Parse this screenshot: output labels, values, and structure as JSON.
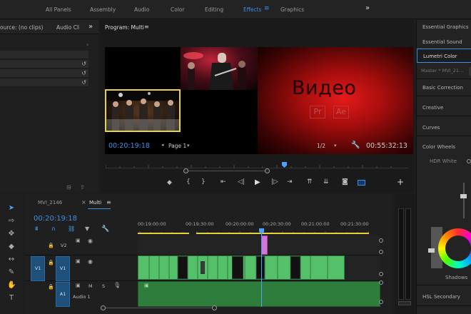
{
  "workspace": {
    "tabs": [
      "All Panels",
      "Assembly",
      "Audio",
      "Color",
      "Editing",
      "Effects",
      "Graphics"
    ],
    "active_tab": "Effects",
    "menu_icon": "hamburger-icon",
    "overflow": "»"
  },
  "source": {
    "title": "ource: (no clips)",
    "audio_tab": "Audio Cli",
    "overflow": "»"
  },
  "program": {
    "title": "Program: Multi",
    "menu": "≡",
    "timecode_in": "00:20:19:18",
    "page_select": "Page 1",
    "zoom_select": "1/2",
    "timecode_out": "00:55:32:13",
    "video_title": "Видео",
    "badge_pr": "Pr",
    "badge_ae": "Ae"
  },
  "timeline": {
    "tab_inactive": "MVI_2146",
    "tab_active": "Multi",
    "tab_menu": "≡",
    "timecode": "00:20:19:18",
    "ruler": [
      "00:19:00:00",
      "00:19:30:00",
      "00:20:00:00",
      "00:20:30:00",
      "00:21:00:00",
      "00:21:30:00"
    ],
    "tracks": {
      "v2": "V2",
      "v1_src": "V1",
      "v1": "V1",
      "a1_src": "A1",
      "a1": "A1",
      "a1_name": "Audio 1",
      "m": "M",
      "s": "S"
    }
  },
  "right_panel": {
    "essential_graphics": "Essential Graphics",
    "essential_sound": "Essential Sound",
    "lumetri": "Lumetri Color",
    "master": "Master * MVI_21...",
    "basic_correction": "Basic Correction",
    "creative": "Creative",
    "curves": "Curves",
    "color_wheels": "Color Wheels",
    "hdr_white": "HDR White",
    "shadows": "Shadows",
    "hsl": "HSL Secondary"
  },
  "colors": {
    "accent": "#3d8ee8",
    "clip_green": "#55c06a",
    "audio_green": "#2f7d3d",
    "playhead": "#4aa3ff",
    "in_out_yellow": "#e1d23b"
  }
}
